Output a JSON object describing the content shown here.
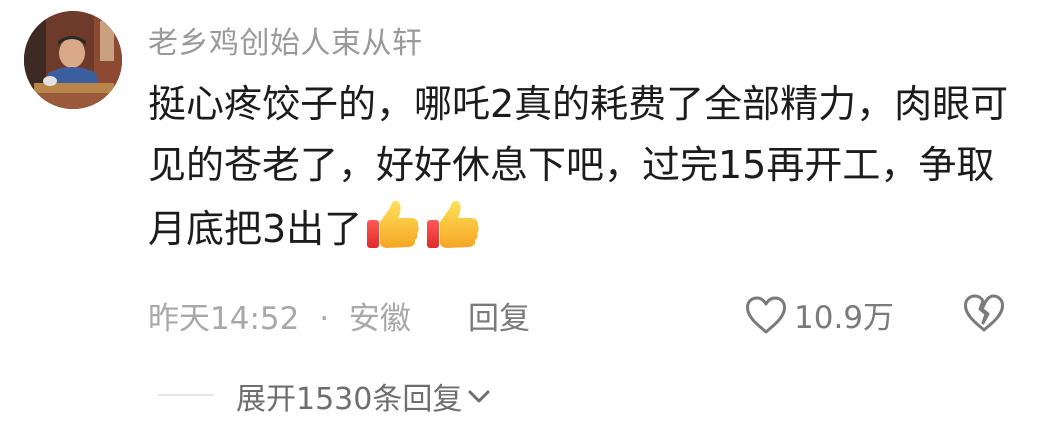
{
  "comment": {
    "username": "老乡鸡创始人束从轩",
    "text": "挺心疼饺子的，哪吒2真的耗费了全部精力，肉眼可见的苍老了，好好休息下吧，过完15再开工，争取月底把3出了",
    "emoji": [
      "thumbs-up",
      "thumbs-up"
    ],
    "meta": {
      "time": "昨天14:52",
      "separator": "·",
      "location": "安徽",
      "reply_label": "回复",
      "likes": "10.9万"
    },
    "expand_replies_label": "展开1530条回复"
  }
}
